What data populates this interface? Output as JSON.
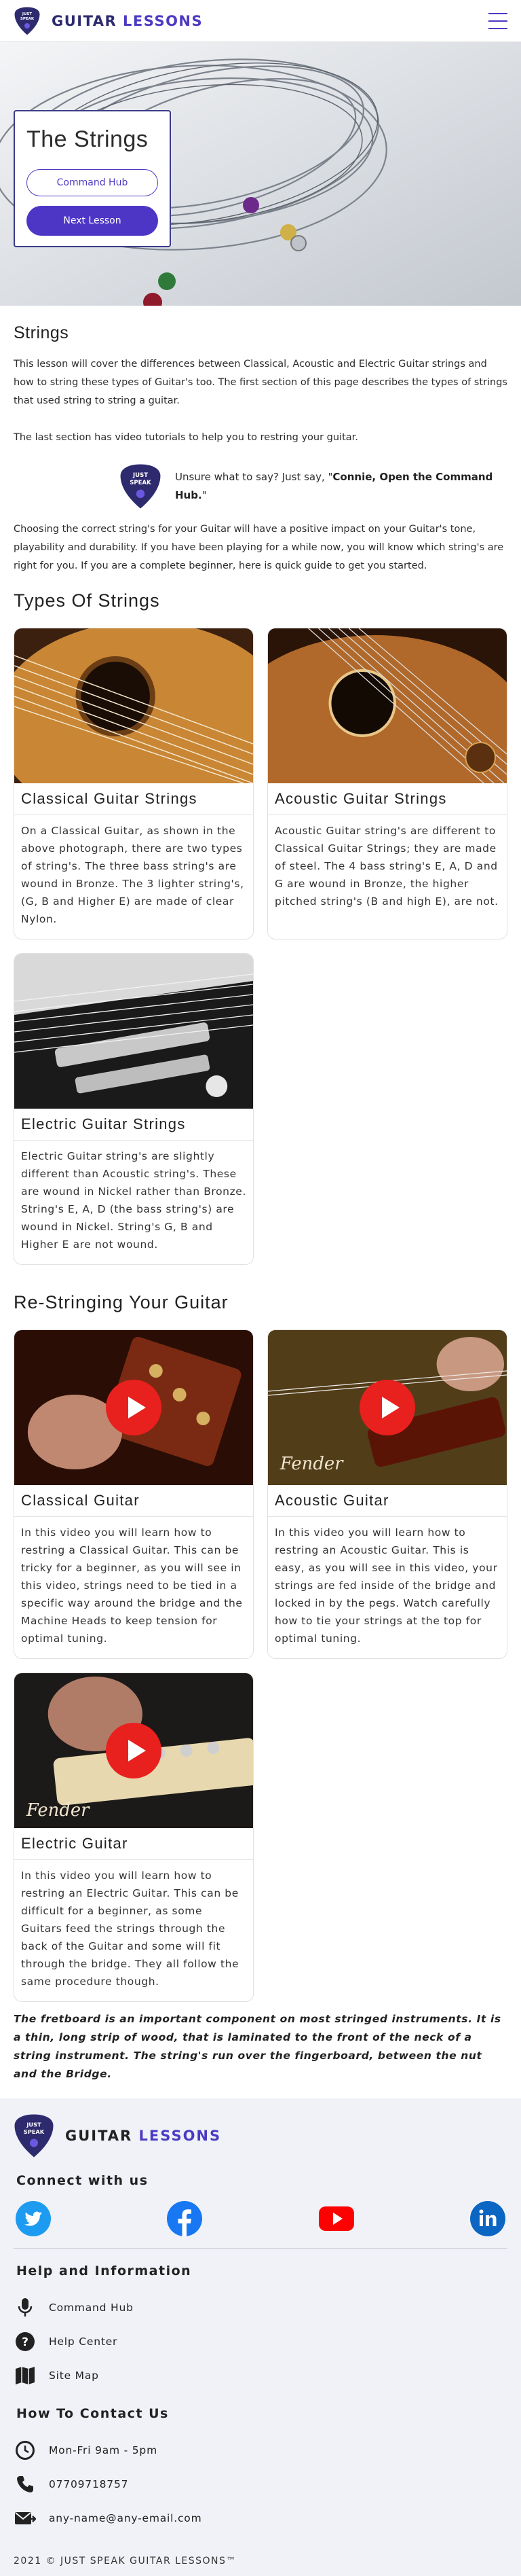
{
  "nav": {
    "brand_part1": "GUITAR",
    "brand_part2": "LESSONS",
    "logo_text1": "JUST",
    "logo_text2": "SPEAK"
  },
  "hero": {
    "title": "The Strings",
    "command_button": "Command Hub",
    "next_button": "Next Lesson"
  },
  "intro": {
    "heading": "Strings",
    "para1": "This lesson will cover the differences between Classical, Acoustic and Electric Guitar strings and how to string these types of Guitar's too. The first section of this page describes the types of strings that used string to string a guitar.",
    "para2": "The last section has video tutorials to help you to restring your guitar.",
    "hint_prefix": "Unsure what to say? Just say, \"",
    "hint_bold": "Connie, Open the Command Hub.",
    "hint_suffix": "\"",
    "para3": "Choosing the correct string's for your Guitar will have a positive impact on your Guitar's tone, playability and durability. If you have been playing for a while now, you will know which string's are right for you. If you are a complete beginner, here is quick guide to get you started."
  },
  "types": {
    "heading": "Types Of Strings",
    "cards": [
      {
        "title": "Classical Guitar Strings",
        "text": "On a Classical Guitar, as shown in the above photograph, there are two types of string's. The three bass string's are wound in Bronze. The 3 lighter string's, (G, B and Higher E) are made of clear Nylon."
      },
      {
        "title": "Acoustic Guitar Strings",
        "text": "Acoustic Guitar string's are different to Classical Guitar Strings; they are made of steel. The 4 bass string's E, A, D and G are wound in Bronze, the higher pitched string's (B and high E), are not."
      },
      {
        "title": "Electric Guitar Strings",
        "text": "Electric Guitar string's are slightly different than Acoustic string's. These are wound in Nickel rather than Bronze. String's E, A, D (the bass string's) are wound in Nickel. String's G, B and Higher E are not wound."
      }
    ]
  },
  "restring": {
    "heading": "Re-Stringing Your Guitar",
    "cards": [
      {
        "title": "Classical Guitar",
        "text": "In this video you will learn how to restring a Classical Guitar. This can be tricky for a beginner, as you will see in this video, strings need to be tied in a specific way around the bridge and the Machine Heads to keep tension for optimal tuning."
      },
      {
        "title": "Acoustic Guitar",
        "text": "In this video you will learn how to restring an Acoustic Guitar. This is easy, as you will see in this video, your strings are fed inside of the bridge and locked in by the pegs. Watch carefully how to tie your strings at the top for optimal tuning."
      },
      {
        "title": "Electric Guitar",
        "text": "In this video you will learn how to restring an Electric Guitar. This can be difficult for a beginner, as some Guitars feed the strings through the back of the Guitar and some will fit through the bridge. They all follow the same procedure though."
      }
    ],
    "watermark": "Fender"
  },
  "fretboard_note": "The fretboard is an important component on most stringed instruments. It is a thin, long strip of wood, that is laminated to the front of the neck of a string instrument. The string's run over the fingerboard, between the nut and the Bridge.",
  "footer": {
    "brand_part1": "GUITAR",
    "brand_part2": "LESSONS",
    "connect_heading": "Connect with us",
    "help_heading": "Help and Information",
    "help_items": [
      "Command Hub",
      "Help Center",
      "Site Map"
    ],
    "contact_heading": "How To Contact Us",
    "hours": "Mon-Fri 9am - 5pm",
    "phone": "07709718757",
    "email": "any-name@any-email.com",
    "copyright": "2021 © JUST SPEAK GUITAR LESSONS™",
    "social_colors": {
      "twitter": "#1d9bf0",
      "facebook": "#1877f2",
      "youtube": "#ff0000",
      "linkedin": "#0a66c2"
    }
  },
  "colors": {
    "brand": "#4c3ac2",
    "brand_dark": "#2e2a6e",
    "play": "#e8201e"
  }
}
